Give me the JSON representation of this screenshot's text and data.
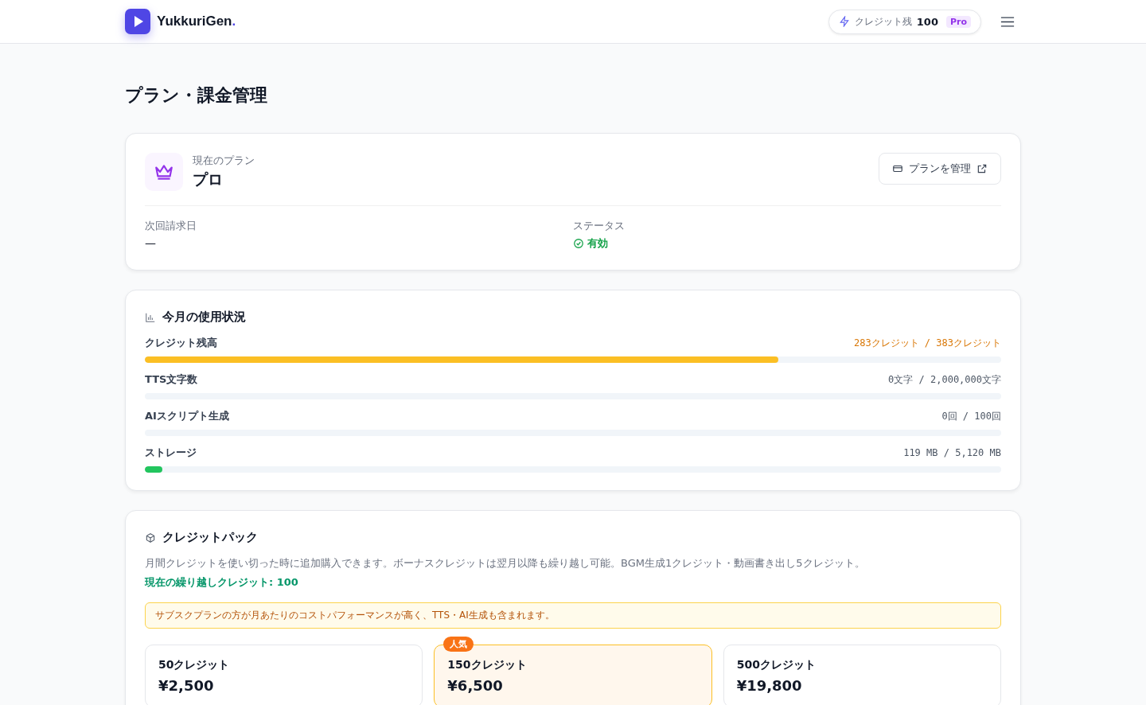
{
  "header": {
    "logo": "YukkuriGen",
    "logo_dot": ".",
    "credits_label": "クレジット残",
    "credits_value": "100",
    "plan_badge": "Pro"
  },
  "page_title": "プラン・課金管理",
  "current_plan": {
    "label": "現在のプラン",
    "name": "プロ",
    "manage_button": "プランを管理",
    "next_billing_label": "次回請求日",
    "next_billing_value": "—",
    "status_label": "ステータス",
    "status_value": "有効",
    "status_active": true
  },
  "usage": {
    "title": "今月の使用状況",
    "rows": [
      {
        "name": "クレジット残高",
        "reading": "283クレジット / 383クレジット",
        "level": 0.74,
        "color": "#fbbf24",
        "highlight": true
      },
      {
        "name": "TTS文字数",
        "reading": "0文字 / 2,000,000文字",
        "level": 0,
        "highlight": false
      },
      {
        "name": "AIスクリプト生成",
        "reading": "0回 / 100回",
        "level": 0,
        "highlight": false
      },
      {
        "name": "ストレージ",
        "reading": "119 MB / 5,120 MB",
        "level": 0.02,
        "color": "#22c55e",
        "highlight": false
      }
    ]
  },
  "credit_packs": {
    "title": "クレジットパック",
    "description": "月間クレジットを使い切った時に追加購入できます。ボーナスクレジットは翌月以降も繰り越し可能。BGM生成1クレジット・動画書き出し5クレジット。",
    "carryover": "現在の繰り越しクレジット: 100",
    "notice": "サブスクプランの方が月あたりのコストパフォーマンスが高く、TTS・AI生成も含まれます。",
    "packs": [
      {
        "name": "50クレジット",
        "price": "¥2,500",
        "popular": false
      },
      {
        "name": "150クレジット",
        "price": "¥6,500",
        "popular": true,
        "badge": "人気"
      },
      {
        "name": "500クレジット",
        "price": "¥19,800",
        "popular": false
      }
    ]
  }
}
